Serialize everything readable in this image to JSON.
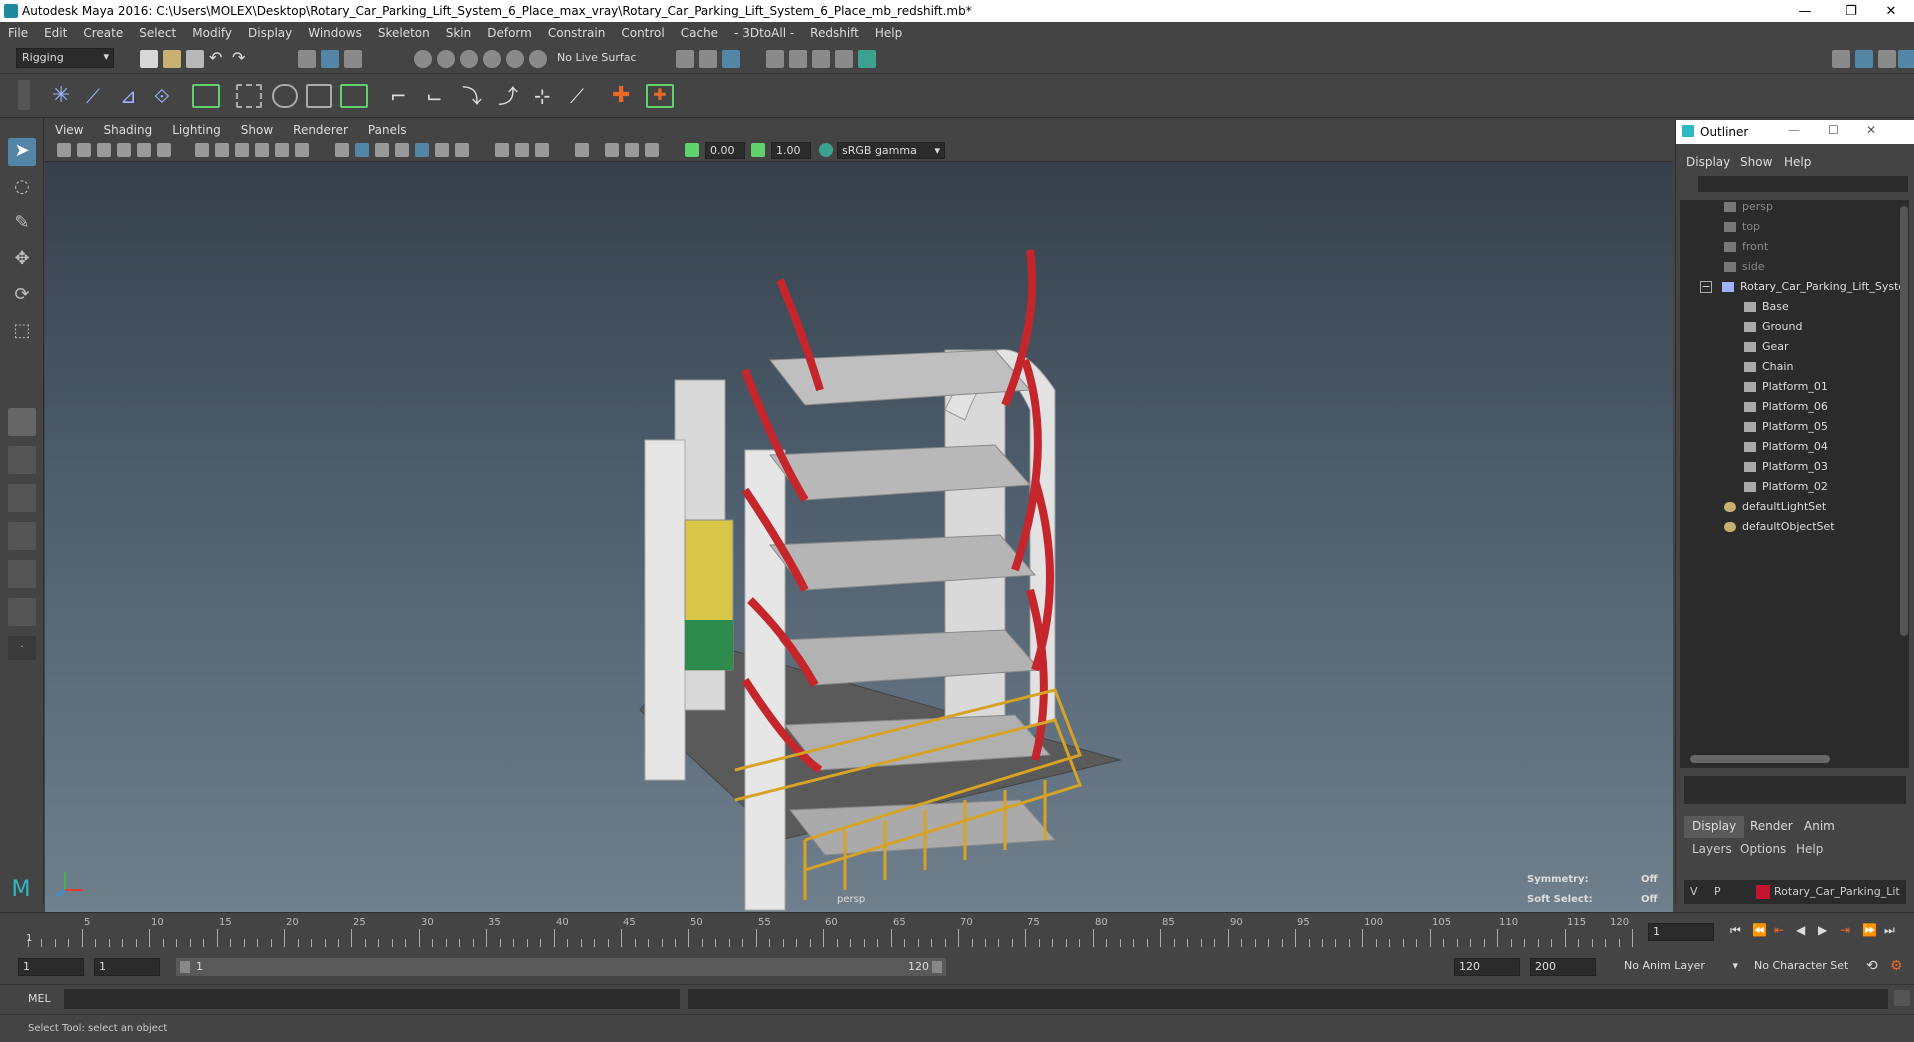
{
  "window": {
    "title": "Autodesk Maya 2016: C:\\Users\\MOLEX\\Desktop\\Rotary_Car_Parking_Lift_System_6_Place_max_vray\\Rotary_Car_Parking_Lift_System_6_Place_mb_redshift.mb*",
    "minimize": "—",
    "restore": "❐",
    "close": "✕"
  },
  "menubar": [
    "File",
    "Edit",
    "Create",
    "Select",
    "Modify",
    "Display",
    "Windows",
    "Skeleton",
    "Skin",
    "Deform",
    "Constrain",
    "Control",
    "Cache",
    "- 3DtoAll -",
    "Redshift",
    "Help"
  ],
  "shelf": {
    "mode": "Rigging",
    "live_surface": "No Live Surface"
  },
  "viewport": {
    "menu": [
      "View",
      "Shading",
      "Lighting",
      "Show",
      "Renderer",
      "Panels"
    ],
    "exposure": "0.00",
    "gamma": "1.00",
    "color_space": "sRGB gamma",
    "camera_label": "persp",
    "hud": {
      "symmetry_label": "Symmetry:",
      "symmetry_value": "Off",
      "soft_select_label": "Soft Select:",
      "soft_select_value": "Off"
    }
  },
  "outliner": {
    "title": "Outliner",
    "menu": [
      "Display",
      "Show",
      "Help"
    ],
    "items": [
      {
        "label": "persp",
        "kind": "camera",
        "dim": true
      },
      {
        "label": "top",
        "kind": "camera",
        "dim": true
      },
      {
        "label": "front",
        "kind": "camera",
        "dim": true
      },
      {
        "label": "side",
        "kind": "camera",
        "dim": true
      },
      {
        "label": "Rotary_Car_Parking_Lift_Syste",
        "kind": "group",
        "dim": false
      },
      {
        "label": "Base",
        "kind": "mesh",
        "dim": false
      },
      {
        "label": "Ground",
        "kind": "mesh",
        "dim": false
      },
      {
        "label": "Gear",
        "kind": "mesh",
        "dim": false
      },
      {
        "label": "Chain",
        "kind": "mesh",
        "dim": false
      },
      {
        "label": "Platform_01",
        "kind": "mesh",
        "dim": false
      },
      {
        "label": "Platform_06",
        "kind": "mesh",
        "dim": false
      },
      {
        "label": "Platform_05",
        "kind": "mesh",
        "dim": false
      },
      {
        "label": "Platform_04",
        "kind": "mesh",
        "dim": false
      },
      {
        "label": "Platform_03",
        "kind": "mesh",
        "dim": false
      },
      {
        "label": "Platform_02",
        "kind": "mesh",
        "dim": false
      },
      {
        "label": "defaultLightSet",
        "kind": "set",
        "dim": false
      },
      {
        "label": "defaultObjectSet",
        "kind": "set",
        "dim": false
      }
    ]
  },
  "layer_editor": {
    "tabs": [
      "Display",
      "Render",
      "Anim"
    ],
    "menu": [
      "Layers",
      "Options",
      "Help"
    ],
    "layer": {
      "v": "V",
      "p": "P",
      "name": "Rotary_Car_Parking_Lit",
      "color": "#c0152c"
    }
  },
  "timeline": {
    "ticks": [
      "5",
      "10",
      "15",
      "20",
      "25",
      "30",
      "35",
      "40",
      "45",
      "50",
      "55",
      "60",
      "65",
      "70",
      "75",
      "80",
      "85",
      "90",
      "95",
      "100",
      "105",
      "110",
      "115",
      "120"
    ],
    "start_frame_label": "1",
    "current_frame": "1"
  },
  "range": {
    "start": "1",
    "playback_start": "1",
    "slider_start": "1",
    "slider_end": "120",
    "playback_end": "120",
    "end": "200",
    "anim_layer": "No Anim Layer",
    "character_set": "No Character Set"
  },
  "command": {
    "lang": "MEL"
  },
  "help": {
    "text": "Select Tool: select an object"
  },
  "colors": {
    "accent": "#5285a6",
    "frame_red": "#c4262c",
    "rail_yellow": "#d6a324"
  }
}
